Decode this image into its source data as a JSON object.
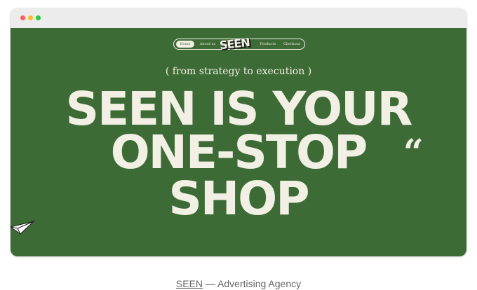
{
  "colors": {
    "background": "#3d6b35",
    "cream": "#f2efe4",
    "titlebar": "#ececec"
  },
  "nav": {
    "items": [
      "Home",
      "About us",
      "Products",
      "Checkout"
    ],
    "logo": "SEEN"
  },
  "hero": {
    "tagline": "( from strategy to execution )",
    "line1": "SEEN IS YOUR",
    "line2": "ONE-STOP",
    "line3": "SHOP",
    "quote_mark": "“"
  },
  "caption": {
    "brand": "SEEN",
    "separator": " — ",
    "description": "Advertising Agency"
  },
  "icons": [
    "paper-plane-icon"
  ]
}
